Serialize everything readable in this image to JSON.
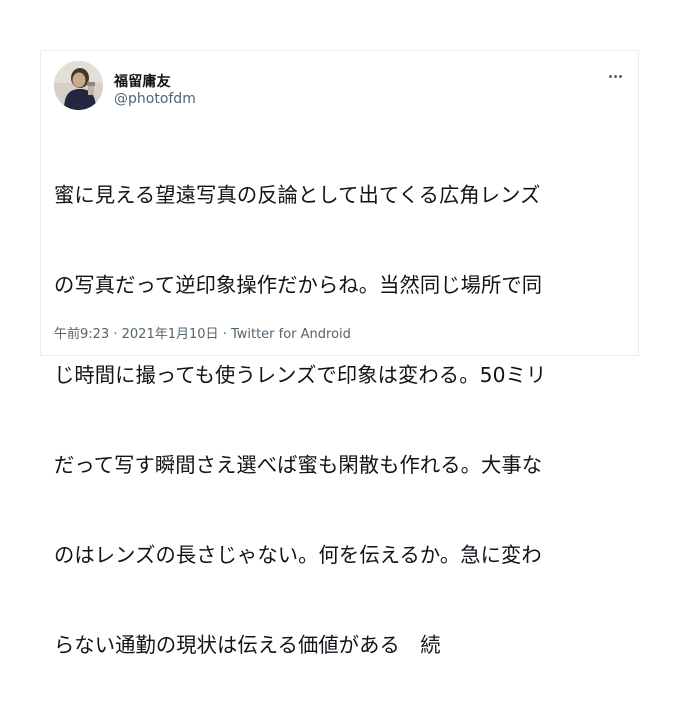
{
  "tweet": {
    "display_name": "福留庸友",
    "handle": "@photofdm",
    "text_lines": [
      "蜜に見える望遠写真の反論として出てくる広角レンズ",
      "の写真だって逆印象操作だからね。当然同じ場所で同",
      "じ時間に撮っても使うレンズで印象は変わる。50ミリ",
      "だって写す瞬間さえ選べば蜜も閑散も作れる。大事な",
      "のはレンズの長さじゃない。何を伝えるか。急に変わ",
      "らない通勤の現状は伝える価値がある　続"
    ],
    "time": "午前9:23",
    "separator": "·",
    "date": "2021年1月10日",
    "source": "Twitter for Android"
  },
  "icons": {
    "more": "more-horizontal-icon",
    "avatar": "profile-avatar"
  }
}
